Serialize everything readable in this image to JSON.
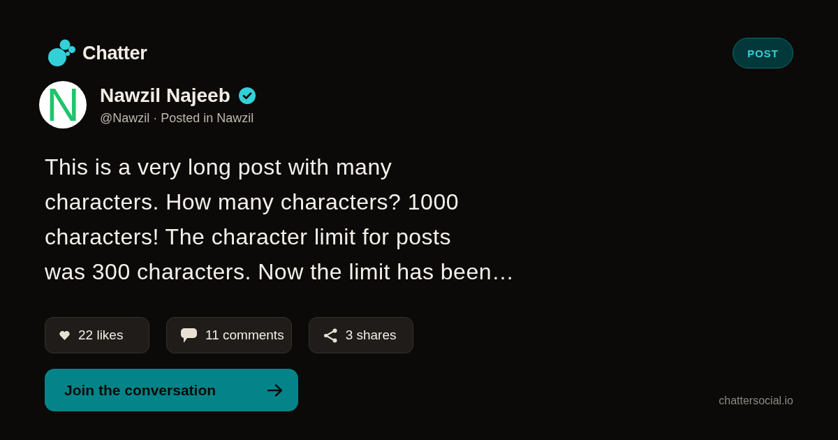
{
  "brand": {
    "name": "Chatter"
  },
  "badge": "POST",
  "author": {
    "avatar_letter": "N",
    "name": "Nawzil Najeeb",
    "verified": true,
    "byline": "@Nawzil · Posted in Nawzil"
  },
  "post": {
    "text": "This is a very long post with many\ncharacters. How many characters? 1000\ncharacters! The character limit for posts\nwas 300 characters. Now the limit has been…"
  },
  "stats": [
    {
      "kind": "likes",
      "label": "22 likes"
    },
    {
      "kind": "comments",
      "label": "11 comments"
    },
    {
      "kind": "shares",
      "label": "3 shares"
    }
  ],
  "cta": {
    "label": "Join the conversation"
  },
  "footer": {
    "domain": "chattersocial.io"
  }
}
